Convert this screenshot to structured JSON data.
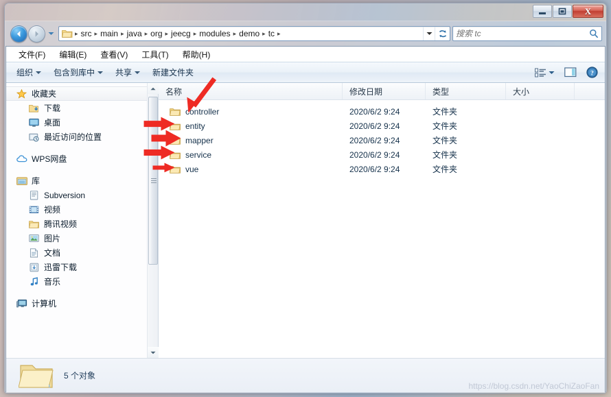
{
  "window": {
    "controls": {
      "minimize": "minimize-button",
      "maximize": "restore-button",
      "close_label": "X"
    }
  },
  "nav": {
    "back": "back-button",
    "forward": "forward-button",
    "history_dropdown": "history-dropdown",
    "breadcrumb": [
      "src",
      "main",
      "java",
      "org",
      "jeecg",
      "modules",
      "demo",
      "tc"
    ],
    "separator": "▸",
    "address_dropdown": "address-dropdown",
    "refresh": "refresh-button"
  },
  "search": {
    "placeholder": "搜索 tc",
    "value": ""
  },
  "menubar": {
    "items": [
      "文件(F)",
      "编辑(E)",
      "查看(V)",
      "工具(T)",
      "帮助(H)"
    ]
  },
  "toolbar": {
    "organize": "组织",
    "include_in_library": "包含到库中",
    "share": "共享",
    "new_folder": "新建文件夹",
    "view_icon": "view-options-icon",
    "preview_pane_icon": "preview-pane-icon",
    "help_icon": "help-icon"
  },
  "sidebar": {
    "groups": [
      {
        "label": "收藏夹",
        "icon": "star-icon",
        "selected": true,
        "children": [
          {
            "label": "下载",
            "icon": "downloads-icon"
          },
          {
            "label": "桌面",
            "icon": "desktop-icon"
          },
          {
            "label": "最近访问的位置",
            "icon": "recent-places-icon"
          }
        ]
      },
      {
        "label": "WPS网盘",
        "icon": "cloud-icon",
        "children": []
      },
      {
        "label": "库",
        "icon": "library-icon",
        "children": [
          {
            "label": "Subversion",
            "icon": "subversion-icon"
          },
          {
            "label": "视频",
            "icon": "video-icon"
          },
          {
            "label": "腾讯视频",
            "icon": "folder-icon"
          },
          {
            "label": "图片",
            "icon": "pictures-icon"
          },
          {
            "label": "文档",
            "icon": "documents-icon"
          },
          {
            "label": "迅雷下载",
            "icon": "thunder-download-icon"
          },
          {
            "label": "音乐",
            "icon": "music-icon"
          }
        ]
      },
      {
        "label": "计算机",
        "icon": "computer-icon",
        "children": []
      }
    ]
  },
  "filelist": {
    "columns": [
      "名称",
      "修改日期",
      "类型",
      "大小"
    ],
    "rows": [
      {
        "name": "controller",
        "modified": "2020/6/2 9:24",
        "type": "文件夹",
        "size": "",
        "icon": "folder-icon"
      },
      {
        "name": "entity",
        "modified": "2020/6/2 9:24",
        "type": "文件夹",
        "size": "",
        "icon": "folder-icon"
      },
      {
        "name": "mapper",
        "modified": "2020/6/2 9:24",
        "type": "文件夹",
        "size": "",
        "icon": "folder-icon"
      },
      {
        "name": "service",
        "modified": "2020/6/2 9:24",
        "type": "文件夹",
        "size": "",
        "icon": "folder-icon"
      },
      {
        "name": "vue",
        "modified": "2020/6/2 9:24",
        "type": "文件夹",
        "size": "",
        "icon": "folder-icon"
      }
    ]
  },
  "statusbar": {
    "count_text": "5 个对象",
    "icon": "large-folder-icon"
  },
  "watermark": {
    "text": "https://blog.csdn.net/YaoChiZaoFan"
  },
  "annotations": {
    "color": "#ee2b24",
    "arrows": [
      {
        "name": "arrow-to-controller",
        "target": "controller"
      },
      {
        "name": "arrow-to-entity",
        "target": "entity"
      },
      {
        "name": "arrow-to-mapper",
        "target": "mapper"
      },
      {
        "name": "arrow-to-service",
        "target": "service"
      },
      {
        "name": "arrow-to-vue",
        "target": "vue"
      }
    ]
  }
}
